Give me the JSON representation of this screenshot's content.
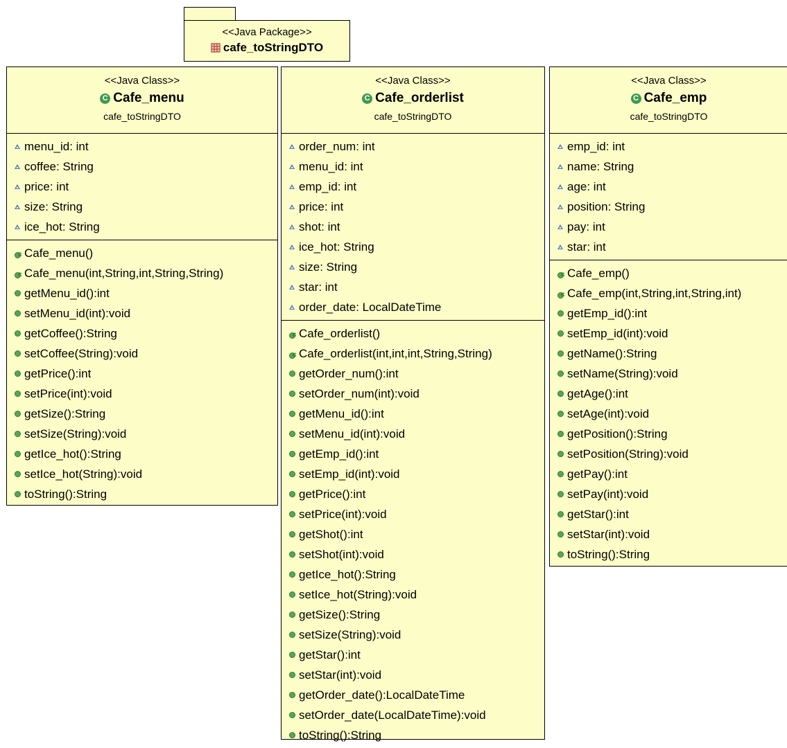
{
  "package": {
    "stereotype": "<<Java Package>>",
    "name": "cafe_toStringDTO",
    "icon": "package-icon"
  },
  "classes": [
    {
      "stereotype": "<<Java Class>>",
      "name": "Cafe_menu",
      "package": "cafe_toStringDTO",
      "attributes": [
        "menu_id: int",
        "coffee: String",
        "price: int",
        "size: String",
        "ice_hot: String"
      ],
      "constructors": [
        "Cafe_menu()",
        "Cafe_menu(int,String,int,String,String)"
      ],
      "methods": [
        "getMenu_id():int",
        "setMenu_id(int):void",
        "getCoffee():String",
        "setCoffee(String):void",
        "getPrice():int",
        "setPrice(int):void",
        "getSize():String",
        "setSize(String):void",
        "getIce_hot():String",
        "setIce_hot(String):void",
        "toString():String"
      ]
    },
    {
      "stereotype": "<<Java Class>>",
      "name": "Cafe_orderlist",
      "package": "cafe_toStringDTO",
      "attributes": [
        "order_num: int",
        "menu_id: int",
        "emp_id: int",
        "price: int",
        "shot: int",
        "ice_hot: String",
        "size: String",
        "star: int",
        "order_date: LocalDateTime"
      ],
      "constructors": [
        "Cafe_orderlist()",
        "Cafe_orderlist(int,int,int,String,String)"
      ],
      "methods": [
        "getOrder_num():int",
        "setOrder_num(int):void",
        "getMenu_id():int",
        "setMenu_id(int):void",
        "getEmp_id():int",
        "setEmp_id(int):void",
        "getPrice():int",
        "setPrice(int):void",
        "getShot():int",
        "setShot(int):void",
        "getIce_hot():String",
        "setIce_hot(String):void",
        "getSize():String",
        "setSize(String):void",
        "getStar():int",
        "setStar(int):void",
        "getOrder_date():LocalDateTime",
        "setOrder_date(LocalDateTime):void",
        "toString():String"
      ]
    },
    {
      "stereotype": "<<Java Class>>",
      "name": "Cafe_emp",
      "package": "cafe_toStringDTO",
      "attributes": [
        "emp_id: int",
        "name: String",
        "age: int",
        "position: String",
        "pay: int",
        "star: int"
      ],
      "constructors": [
        "Cafe_emp()",
        "Cafe_emp(int,String,int,String,int)"
      ],
      "methods": [
        "getEmp_id():int",
        "setEmp_id(int):void",
        "getName():String",
        "setName(String):void",
        "getAge():int",
        "setAge(int):void",
        "getPosition():String",
        "setPosition(String):void",
        "getPay():int",
        "setPay(int):void",
        "getStar():int",
        "setStar(int):void",
        "toString():String"
      ]
    }
  ],
  "colors": {
    "box_fill": "#fdfdc8",
    "border": "#000000",
    "class_icon": "#3f9a4f",
    "field_icon": "#4b74c7",
    "method_icon": "#5aa55a",
    "package_icon": "#b5473a"
  }
}
